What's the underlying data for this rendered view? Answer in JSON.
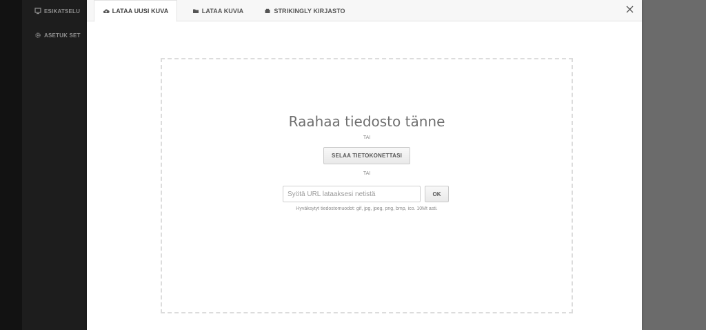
{
  "sidebar": {
    "items": [
      {
        "label": "ESIKATSELU",
        "icon": "preview-icon"
      },
      {
        "label": "ASETUK SET",
        "icon": "gear-icon"
      }
    ]
  },
  "modal": {
    "tabs": [
      {
        "label": "LATAA UUSI KUVA",
        "icon": "cloud-upload-icon",
        "active": true
      },
      {
        "label": "LATAA KUVIA",
        "icon": "folder-icon",
        "active": false
      },
      {
        "label": "STRIKINGLY KIRJASTO",
        "icon": "library-icon",
        "active": false
      }
    ],
    "close_icon": "close-icon"
  },
  "dropzone": {
    "title": "Raahaa tiedosto tänne",
    "or_1": "TAI",
    "browse_label": "SELAA TIETOKONETTASI",
    "or_2": "TAI",
    "url_placeholder": "Syötä URL lataaksesi netistä",
    "ok_label": "OK",
    "formats_note": "Hyväksytyt tiedostomuodot: gif, jpg, jpeg, png, bmp, ico. 10Mt asti."
  },
  "colors": {
    "overlay": "#6b6b6b",
    "sidebar_bg": "#1d1d1d",
    "modal_bg": "#ffffff",
    "tabbar_bg": "#f7f7f7",
    "dashed_border": "#dcdcdc"
  }
}
